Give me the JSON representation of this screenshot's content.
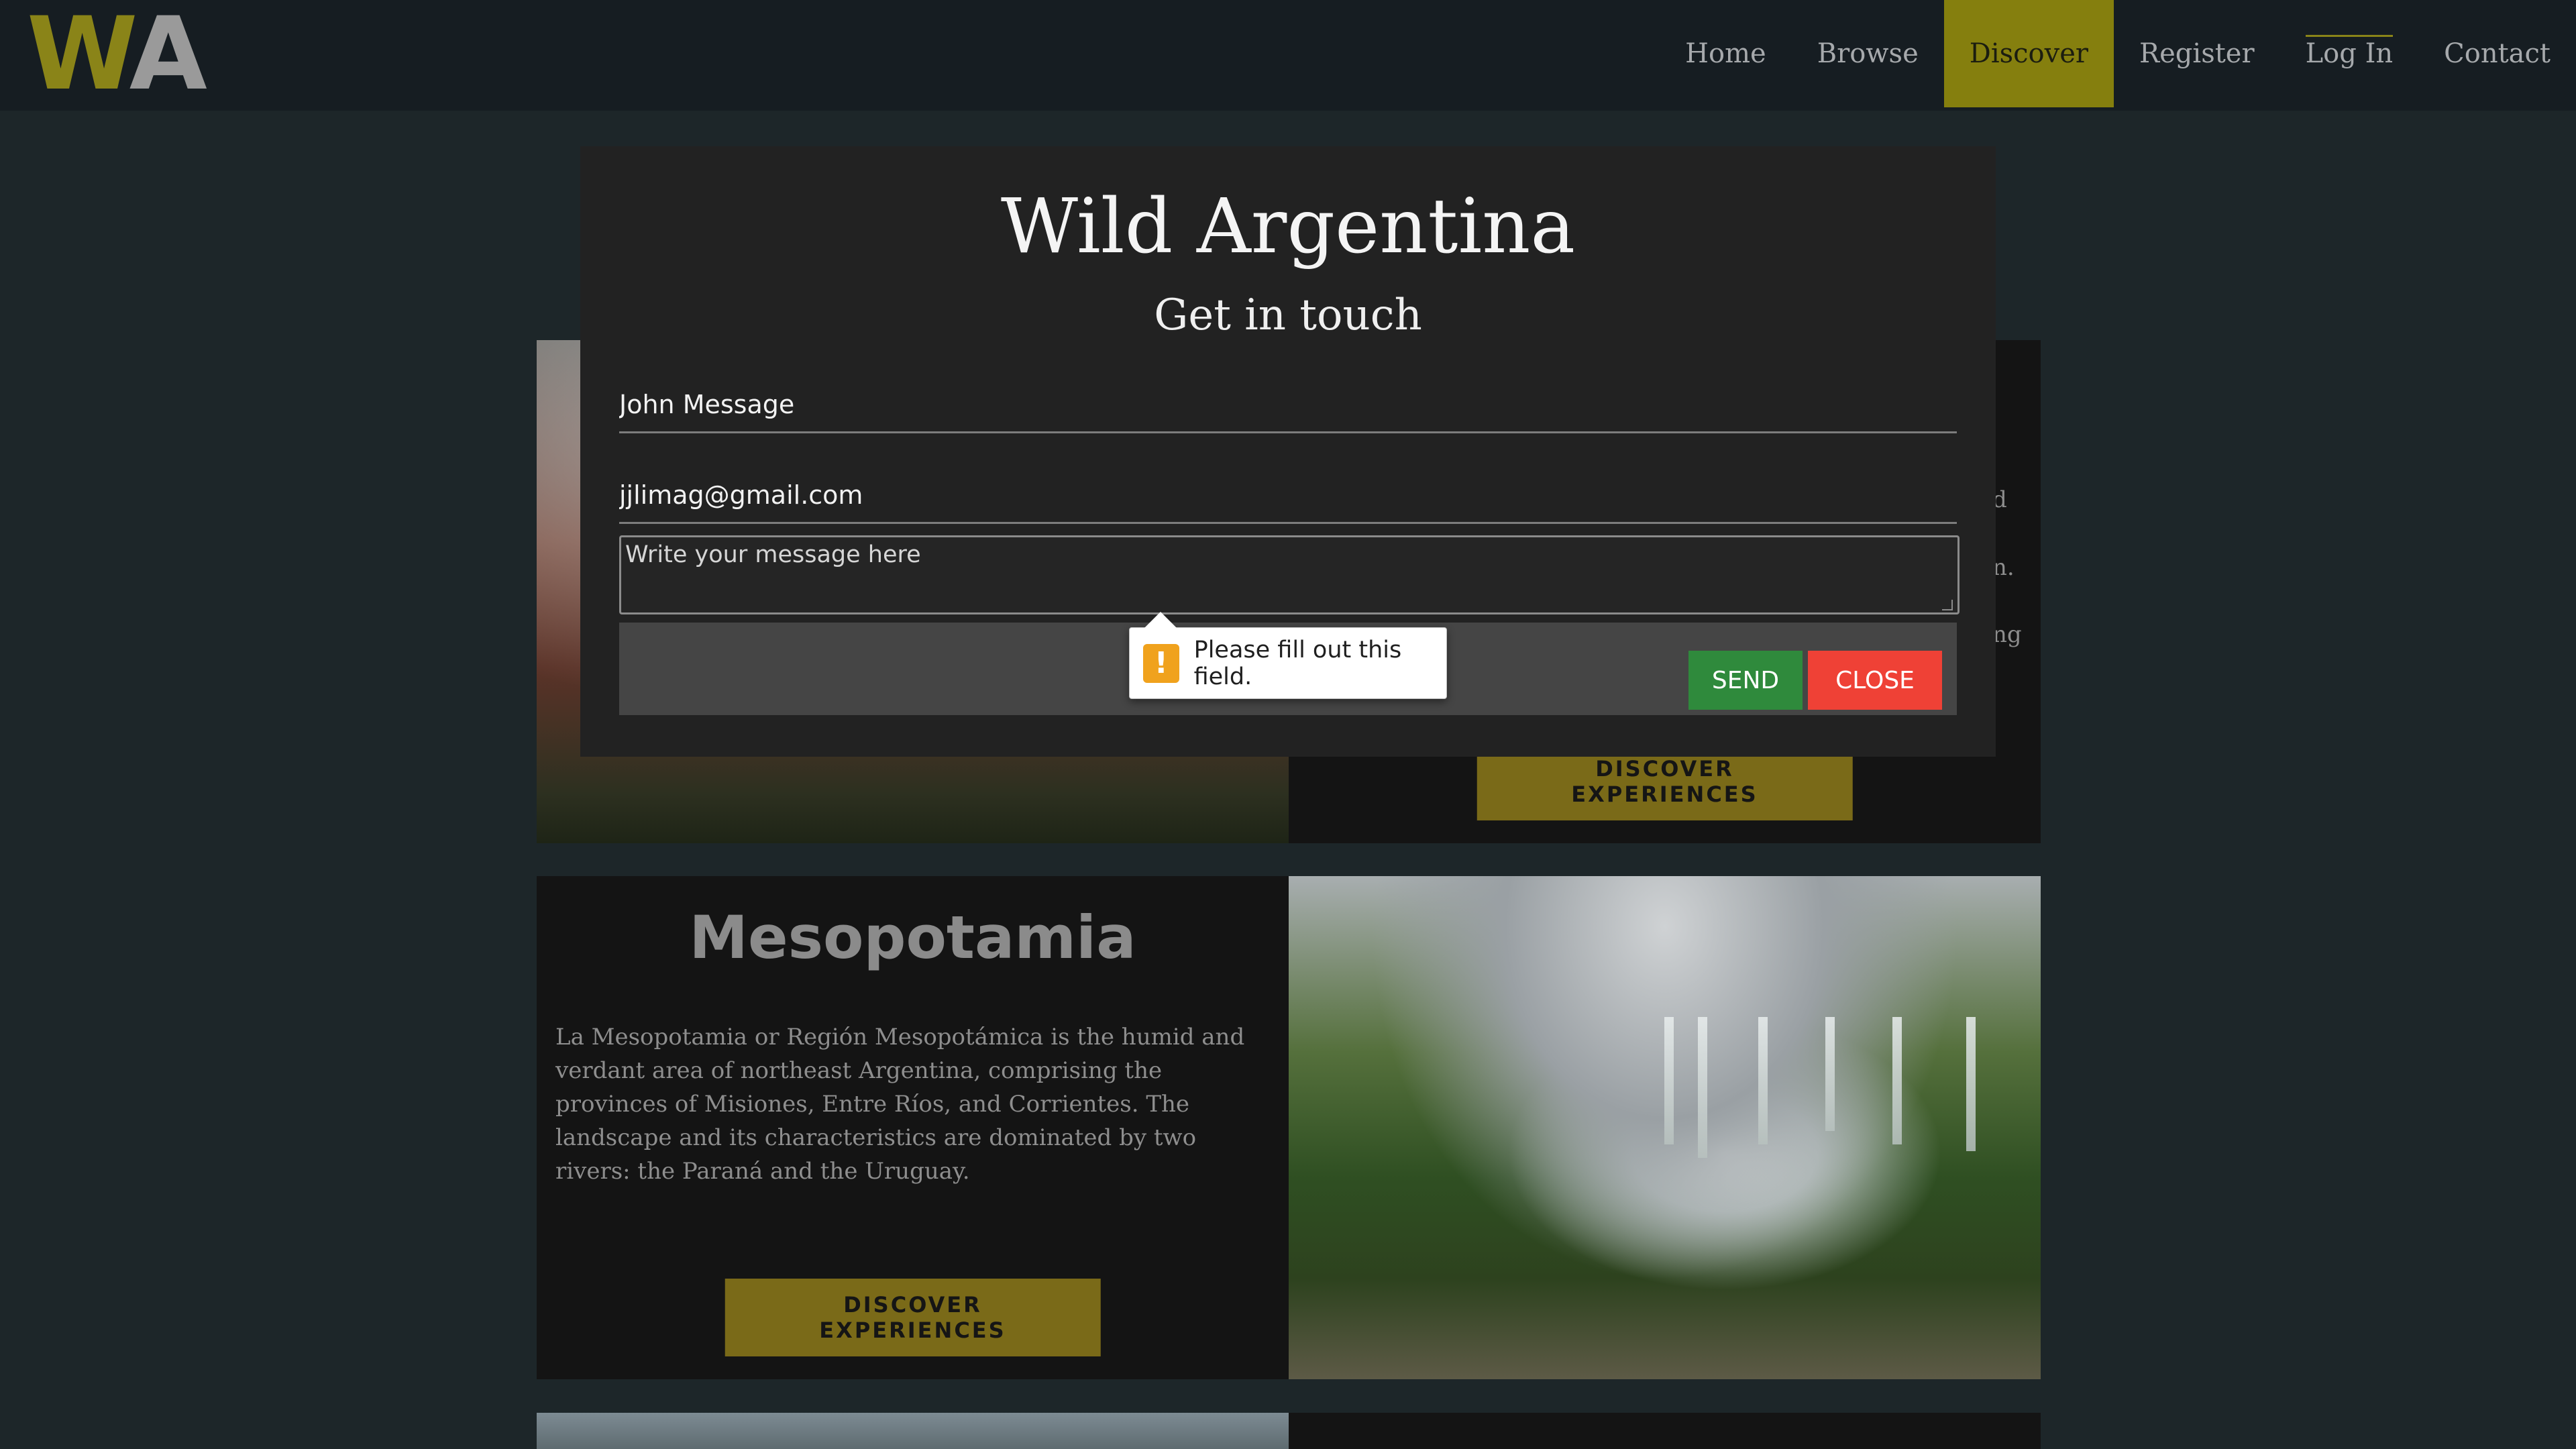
{
  "logo": {
    "part1": "W",
    "part2": "A"
  },
  "nav": {
    "items": [
      {
        "label": "Home"
      },
      {
        "label": "Browse"
      },
      {
        "label": "Discover"
      },
      {
        "label": "Register"
      },
      {
        "label": "Log In"
      },
      {
        "label": "Contact"
      }
    ],
    "active_label": "Discover",
    "accent_color": "#857f0e"
  },
  "modal": {
    "title": "Wild Argentina",
    "subtitle": "Get in touch",
    "name_value": "John Message",
    "email_value": "jjlimag@gmail.com",
    "message_placeholder": "Write your message here",
    "send_label": "SEND",
    "close_label": "CLOSE",
    "send_color": "#2f8a3c",
    "close_color": "#ef4136"
  },
  "validation": {
    "icon": "warning-icon",
    "glyph": "!",
    "message": "Please fill out this field."
  },
  "cards": [
    {
      "peek_lines": [
        "d",
        "n.",
        "ng"
      ],
      "button_label": "DISCOVER EXPERIENCES"
    },
    {
      "title": "Mesopotamia",
      "description": "La Mesopotamia or Región Mesopotámica is the humid and verdant area of northeast Argentina, comprising the provinces of Misiones, Entre Ríos, and Corrientes. The landscape and its characteristics are dominated by two rivers: the Paraná and the Uruguay.",
      "button_label": "DISCOVER EXPERIENCES"
    }
  ]
}
